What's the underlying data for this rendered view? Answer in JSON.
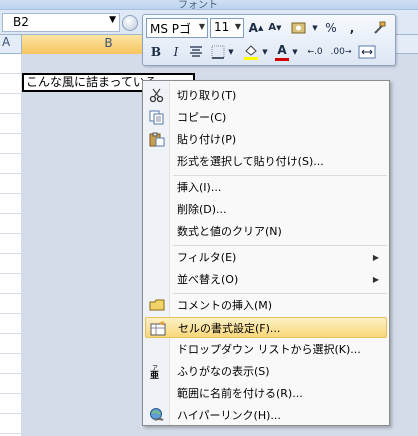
{
  "ribbon": {
    "group_label": "フォント"
  },
  "name_box": {
    "value": "B2"
  },
  "columns": {
    "a": "A",
    "b": "B"
  },
  "cell": {
    "b2_text": "こんな風に詰まっている"
  },
  "mini_toolbar": {
    "font_name": "MS Pゴ",
    "font_size": "11",
    "grow_font": "A",
    "shrink_font": "A",
    "percent": "%",
    "comma": ",",
    "bold": "B",
    "italic": "I",
    "font_color": "A",
    "increase_decimal": ".0",
    "decrease_decimal": ".00",
    "colors": {
      "highlight": "#ffff00",
      "font": "#d00000"
    }
  },
  "context_menu": {
    "items": [
      {
        "label": "切り取り(T)",
        "icon": "scissors-icon"
      },
      {
        "label": "コピー(C)",
        "icon": "copy-icon"
      },
      {
        "label": "貼り付け(P)",
        "icon": "paste-icon"
      },
      {
        "label": "形式を選択して貼り付け(S)..."
      },
      {
        "label": "挿入(I)..."
      },
      {
        "label": "削除(D)..."
      },
      {
        "label": "数式と値のクリア(N)"
      },
      {
        "label": "フィルタ(E)",
        "submenu": true
      },
      {
        "label": "並べ替え(O)",
        "submenu": true
      },
      {
        "label": "コメントの挿入(M)",
        "icon": "comment-icon"
      },
      {
        "label": "セルの書式設定(F)...",
        "icon": "format-cells-icon",
        "highlighted": true
      },
      {
        "label": "ドロップダウン リストから選択(K)..."
      },
      {
        "label": "ふりがなの表示(S)",
        "icon": "furigana-icon"
      },
      {
        "label": "範囲に名前を付ける(R)..."
      },
      {
        "label": "ハイパーリンク(H)...",
        "icon": "hyperlink-icon"
      }
    ]
  },
  "colors": {
    "highlight_menu": "#f9d879",
    "column_selected": "#f7c65d"
  }
}
